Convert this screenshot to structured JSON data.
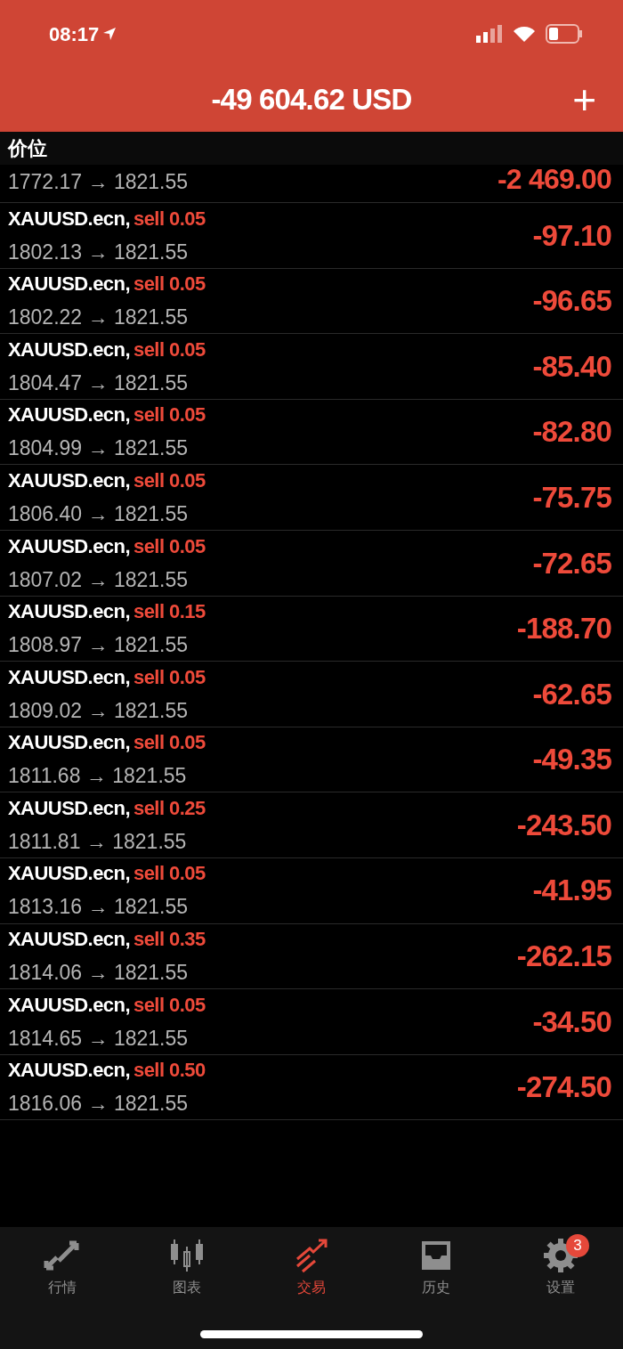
{
  "status_bar": {
    "time": "08:17"
  },
  "header": {
    "balance": "-49 604.62 USD",
    "add_label": "+"
  },
  "section": {
    "title": "价位"
  },
  "top_row": {
    "price": "1772.17 → 1821.55",
    "profit": "-2 469.00"
  },
  "rows": [
    {
      "symbol": "XAUUSD.ecn,",
      "side": "sell 0.05",
      "price": "1802.13 → 1821.55",
      "profit": "-97.10"
    },
    {
      "symbol": "XAUUSD.ecn,",
      "side": "sell 0.05",
      "price": "1802.22 → 1821.55",
      "profit": "-96.65"
    },
    {
      "symbol": "XAUUSD.ecn,",
      "side": "sell 0.05",
      "price": "1804.47 → 1821.55",
      "profit": "-85.40"
    },
    {
      "symbol": "XAUUSD.ecn,",
      "side": "sell 0.05",
      "price": "1804.99 → 1821.55",
      "profit": "-82.80"
    },
    {
      "symbol": "XAUUSD.ecn,",
      "side": "sell 0.05",
      "price": "1806.40 → 1821.55",
      "profit": "-75.75"
    },
    {
      "symbol": "XAUUSD.ecn,",
      "side": "sell 0.05",
      "price": "1807.02 → 1821.55",
      "profit": "-72.65"
    },
    {
      "symbol": "XAUUSD.ecn,",
      "side": "sell 0.15",
      "price": "1808.97 → 1821.55",
      "profit": "-188.70"
    },
    {
      "symbol": "XAUUSD.ecn,",
      "side": "sell 0.05",
      "price": "1809.02 → 1821.55",
      "profit": "-62.65"
    },
    {
      "symbol": "XAUUSD.ecn,",
      "side": "sell 0.05",
      "price": "1811.68 → 1821.55",
      "profit": "-49.35"
    },
    {
      "symbol": "XAUUSD.ecn,",
      "side": "sell 0.25",
      "price": "1811.81 → 1821.55",
      "profit": "-243.50"
    },
    {
      "symbol": "XAUUSD.ecn,",
      "side": "sell 0.05",
      "price": "1813.16 → 1821.55",
      "profit": "-41.95"
    },
    {
      "symbol": "XAUUSD.ecn,",
      "side": "sell 0.35",
      "price": "1814.06 → 1821.55",
      "profit": "-262.15"
    },
    {
      "symbol": "XAUUSD.ecn,",
      "side": "sell 0.05",
      "price": "1814.65 → 1821.55",
      "profit": "-34.50"
    },
    {
      "symbol": "XAUUSD.ecn,",
      "side": "sell 0.50",
      "price": "1816.06 → 1821.55",
      "profit": "-274.50"
    }
  ],
  "tabs": [
    {
      "kind": "quotes",
      "label": "行情",
      "selected": false
    },
    {
      "kind": "chart",
      "label": "图表",
      "selected": false
    },
    {
      "kind": "trade",
      "label": "交易",
      "selected": true
    },
    {
      "kind": "history",
      "label": "历史",
      "selected": false
    },
    {
      "kind": "settings",
      "label": "设置",
      "selected": false,
      "badge": "3"
    }
  ]
}
